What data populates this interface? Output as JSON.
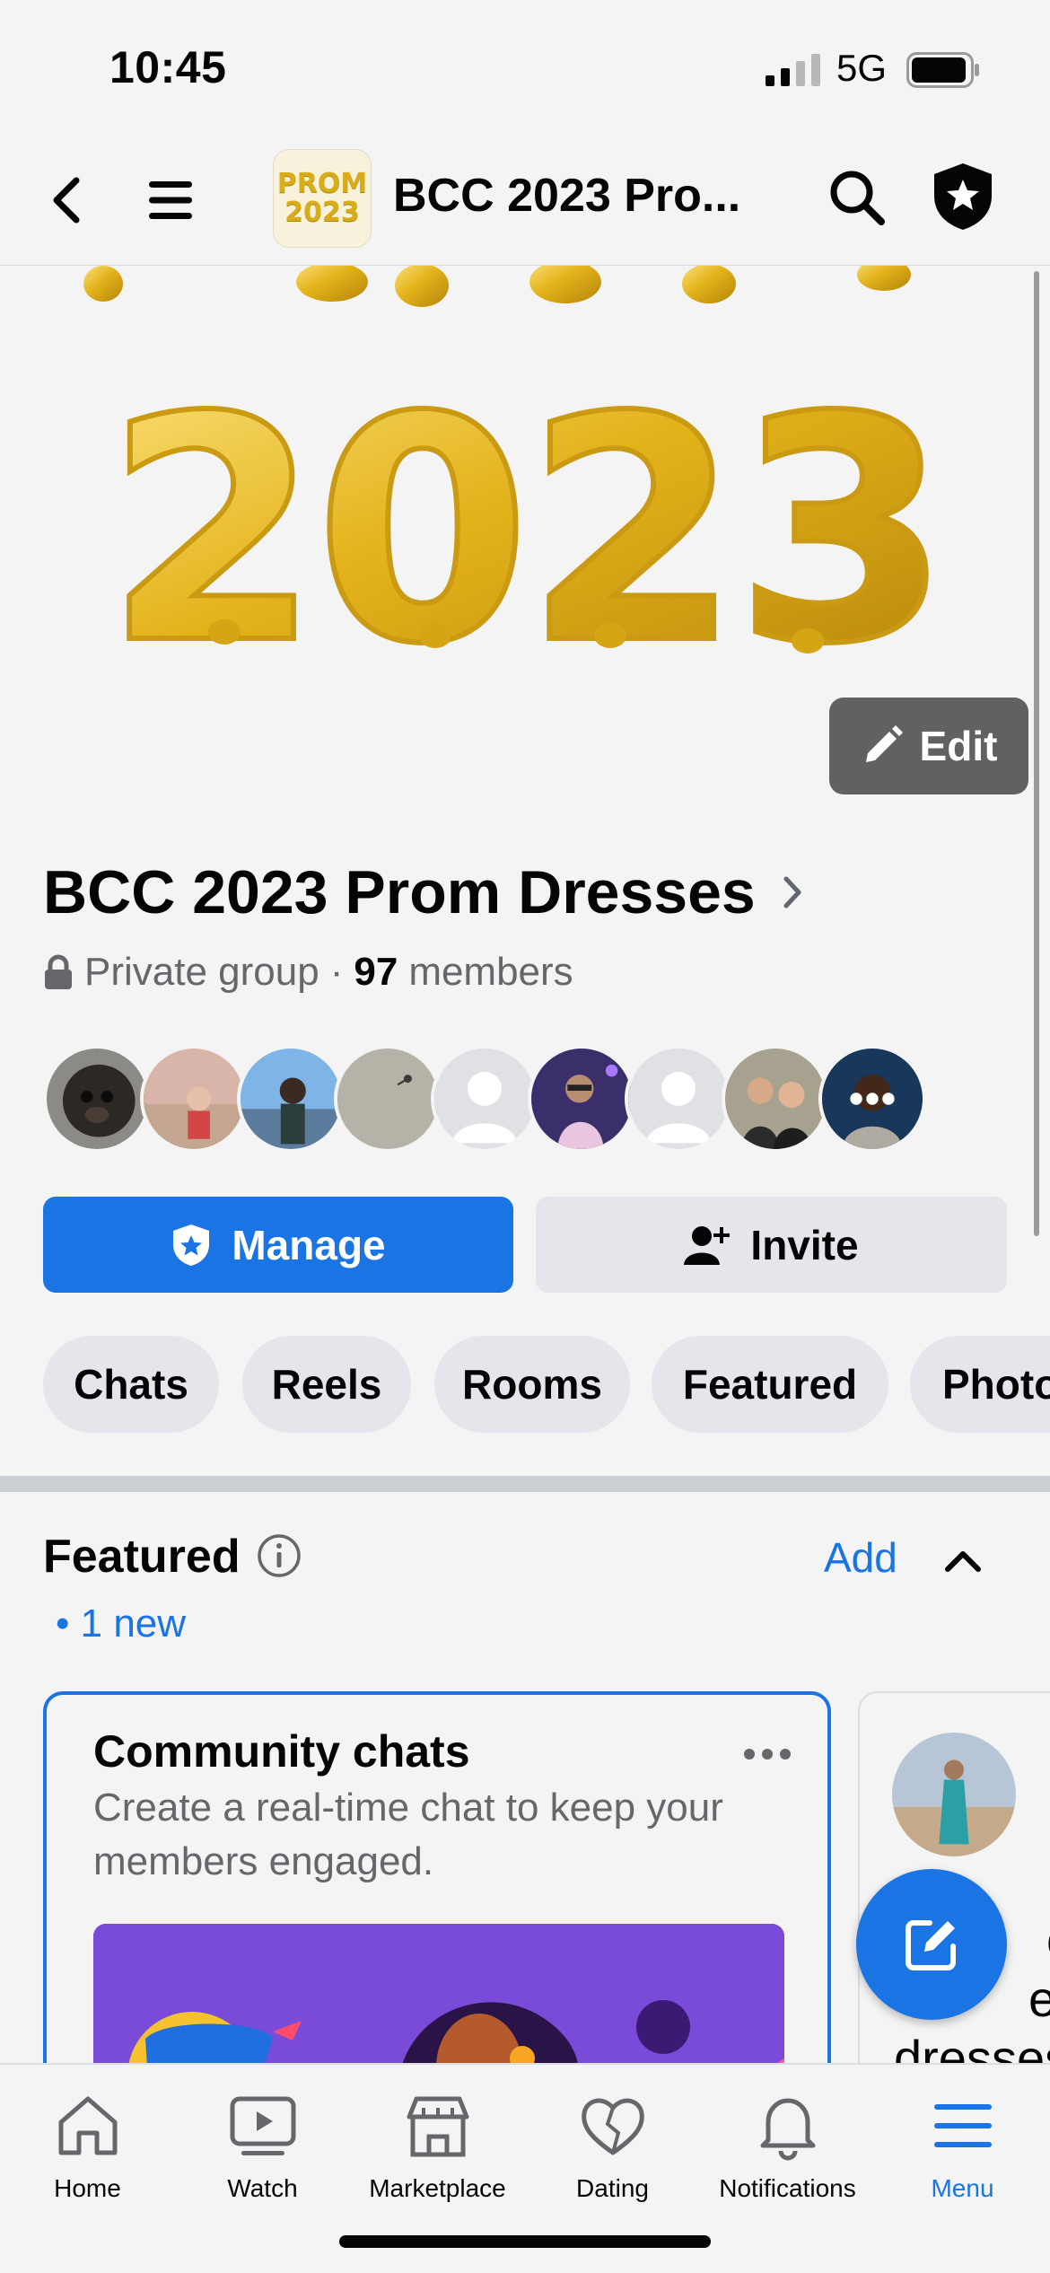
{
  "status_bar": {
    "time": "10:45",
    "network": "5G",
    "icons": [
      "signal-icon",
      "battery-icon"
    ]
  },
  "navbar": {
    "title": "BCC 2023 Pro...",
    "thumb_text_line1": "PROM",
    "thumb_text_line2": "2023",
    "icons": [
      "back-chevron-icon",
      "hamburger-menu-icon",
      "search-icon",
      "admin-shield-icon"
    ]
  },
  "cover": {
    "balloon_text": "2023",
    "edit_label": "Edit"
  },
  "group": {
    "name": "BCC 2023 Prom Dresses",
    "privacy": "Private group",
    "separator": "·",
    "member_count": "97",
    "members_label": "members"
  },
  "actions": {
    "manage_label": "Manage",
    "invite_label": "Invite"
  },
  "tabs": [
    "Chats",
    "Reels",
    "Rooms",
    "Featured",
    "Photos"
  ],
  "featured": {
    "title": "Featured",
    "add_label": "Add",
    "new_badge": "• 1 new",
    "card": {
      "title": "Community chats",
      "description": "Create a real-time chat to keep your members engaged."
    },
    "card2": {
      "text_line1": "cl",
      "text_line2": "e w",
      "text_line3": "dresses"
    }
  },
  "bottom_nav": [
    {
      "label": "Home",
      "icon": "home-icon",
      "active": false
    },
    {
      "label": "Watch",
      "icon": "watch-icon",
      "active": false
    },
    {
      "label": "Marketplace",
      "icon": "marketplace-icon",
      "active": false
    },
    {
      "label": "Dating",
      "icon": "dating-icon",
      "active": false
    },
    {
      "label": "Notifications",
      "icon": "bell-icon",
      "active": false
    },
    {
      "label": "Menu",
      "icon": "menu-icon",
      "active": true
    }
  ],
  "colors": {
    "accent": "#1b74e4",
    "background": "#f4f4f4",
    "secondary_button": "#e4e6eb",
    "muted_text": "#65676b",
    "balloon_gold": "#e3b21a"
  }
}
